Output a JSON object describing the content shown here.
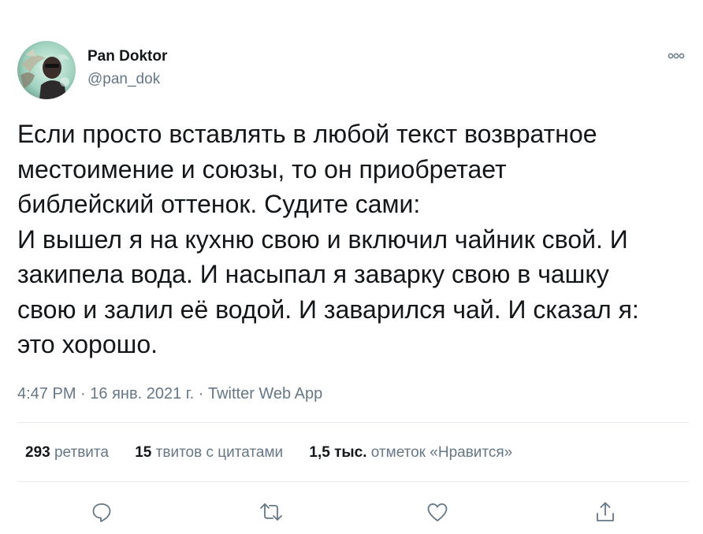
{
  "author": {
    "display_name": "Pan Doktor",
    "handle": "@pan_dok"
  },
  "tweet": {
    "text": "Если просто вставлять в любой текст возвратное\nместоимение и союзы, то он приобретает\nбиблейский оттенок. Судите сами:\nИ вышел я на кухню свою и включил чайник свой. И\nзакипела вода. И насыпал я заварку свою в чашку\nсвою и залил её водой. И заварился чай. И сказал я:\nэто хорошо."
  },
  "meta": {
    "time": "4:47 PM",
    "separator": "·",
    "date": "16 янв. 2021 г.",
    "source": "Twitter Web App"
  },
  "stats": {
    "retweets": {
      "count": "293",
      "label": "ретвита"
    },
    "quotes": {
      "count": "15",
      "label": "твитов с цитатами"
    },
    "likes": {
      "count": "1,5 тыс.",
      "label": "отметок «Нравится»"
    }
  },
  "actions": {
    "icons": [
      "reply-icon",
      "retweet-icon",
      "like-icon",
      "share-icon"
    ]
  },
  "colors": {
    "text_primary": "#14171a",
    "text_secondary": "#657786",
    "icon": "#657786",
    "divider": "#e6ecf0",
    "background": "#ffffff"
  }
}
